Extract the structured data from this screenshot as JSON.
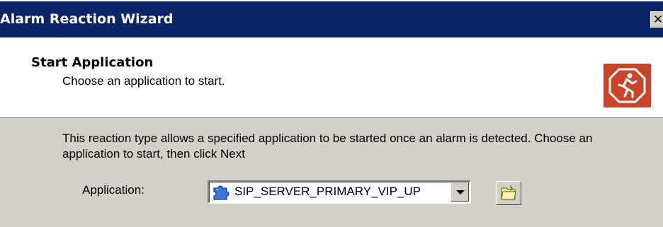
{
  "window": {
    "title": "Alarm Reaction Wizard",
    "close_label": "✕"
  },
  "header": {
    "title": "Start Application",
    "subtitle": "Choose an application to start.",
    "logo_icon": "running-man-stop-sign-icon"
  },
  "main": {
    "description": "This reaction type allows a specified application to be started once an alarm is detected. Choose an application to start, then click Next",
    "application_label": "Application:",
    "application_value": "SIP_SERVER_PRIMARY_VIP_UP",
    "application_icon": "puzzle-piece-icon",
    "browse_icon": "folder-icon"
  },
  "colors": {
    "titlebar": "#0a246a",
    "dialog_bg": "#d4d0c8",
    "logo_bg": "#c8452a"
  }
}
